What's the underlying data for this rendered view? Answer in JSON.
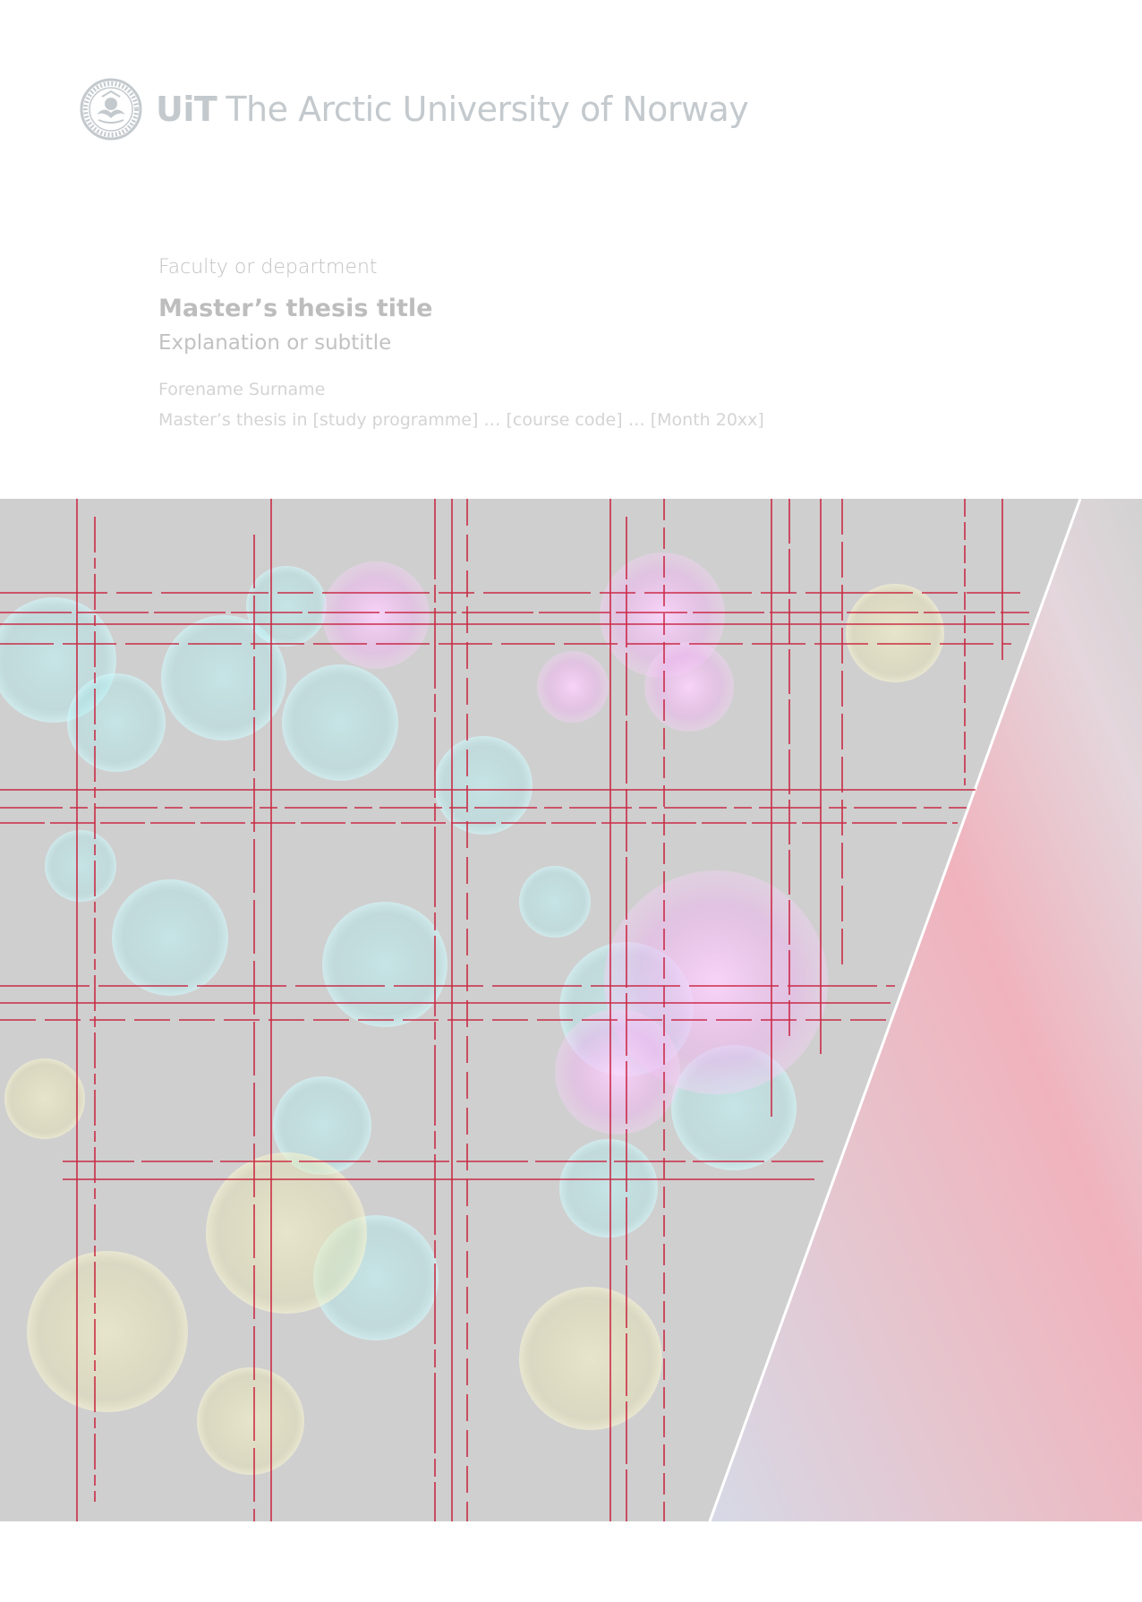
{
  "header": {
    "logo_icon": "uit-seal-icon",
    "logo_bold": "UiT",
    "logo_rest": "The Arctic University of Norway"
  },
  "cover": {
    "faculty": "Faculty or department",
    "title": "Master’s thesis title",
    "subtitle": "Explanation or subtitle",
    "author": "Forename Surname",
    "programme": "Master’s thesis in [study programme] … [course code] … [Month 20xx]"
  },
  "colors": {
    "logo_gray": "#c3c9cd",
    "title_gray": "#bdbdbd",
    "light_text": "#d4d4d4",
    "image_base": "#cfcfcf",
    "gridline_red": "#c8102e"
  }
}
